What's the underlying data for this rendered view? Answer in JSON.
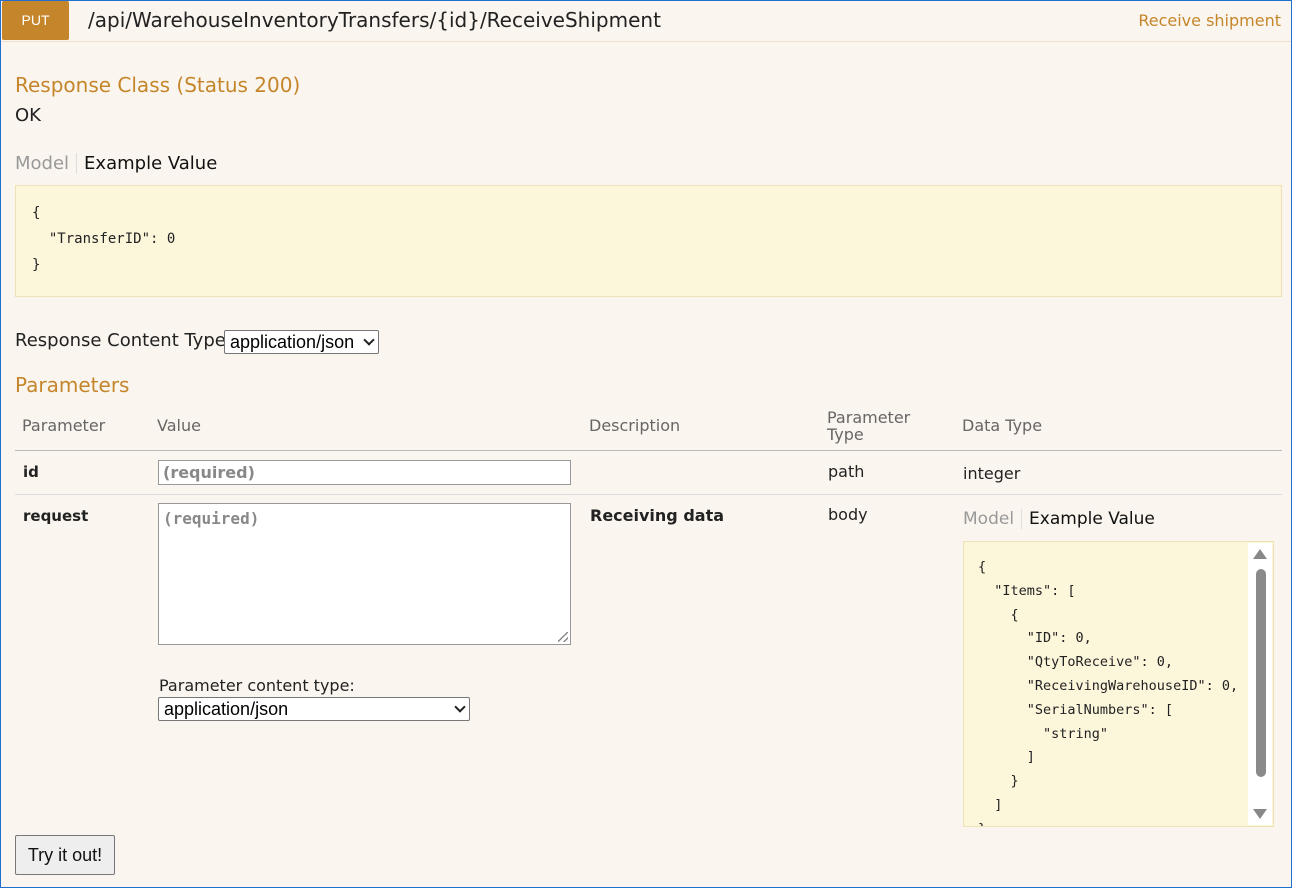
{
  "header": {
    "method": "PUT",
    "path": "/api/WarehouseInventoryTransfers/{id}/ReceiveShipment",
    "summary": "Receive shipment"
  },
  "response": {
    "title": "Response Class (Status 200)",
    "status_text": "OK",
    "tab_model": "Model",
    "tab_example": "Example Value",
    "example_json": "{\n  \"TransferID\": 0\n}"
  },
  "response_content_type": {
    "label": "Response Content Type",
    "selected": "application/json"
  },
  "parameters": {
    "title": "Parameters",
    "columns": {
      "parameter": "Parameter",
      "value": "Value",
      "description": "Description",
      "parameter_type_line1": "Parameter",
      "parameter_type_line2": "Type",
      "data_type": "Data Type"
    },
    "rows": [
      {
        "name": "id",
        "placeholder": "(required)",
        "description": "",
        "param_type": "path",
        "data_type": "integer"
      },
      {
        "name": "request",
        "placeholder": "(required)",
        "description": "Receiving data",
        "param_type": "body",
        "content_type_label": "Parameter content type:",
        "content_type_selected": "application/json",
        "tab_model": "Model",
        "tab_example": "Example Value",
        "example_json": "{\n  \"Items\": [\n    {\n      \"ID\": 0,\n      \"QtyToReceive\": 0,\n      \"ReceivingWarehouseID\": 0,\n      \"SerialNumbers\": [\n        \"string\"\n      ]\n    }\n  ]\n}"
      }
    ]
  },
  "try_button": "Try it out!",
  "colors": {
    "accent": "#c5862b",
    "background": "#faf5ee",
    "code_background": "#fcf6db"
  }
}
